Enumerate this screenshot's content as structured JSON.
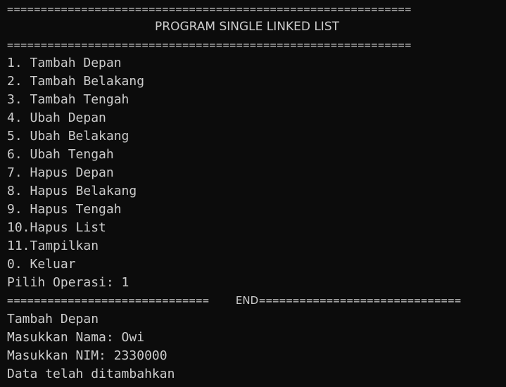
{
  "terminal": {
    "top_separator": "============================================================",
    "title": "PROGRAM SINGLE LINKED LIST",
    "title_separator": "============================================================",
    "menu_items": [
      "1. Tambah Depan",
      "2. Tambah Belakang",
      "3. Tambah Tengah",
      "4. Ubah Depan",
      "5. Ubah Belakang",
      "6. Ubah Tengah",
      "7. Hapus Depan",
      "8. Hapus Belakang",
      "9. Hapus Tengah",
      "10.Hapus List",
      "11.Tampilkan",
      "0. Keluar"
    ],
    "prompt": "Pilih Operasi: 1",
    "end_left": "==============================",
    "end_label": "END",
    "end_right": "==============================",
    "output_lines": [
      "Tambah Depan",
      "Masukkan Nama: Owi",
      "Masukkan NIM: 2330000",
      "Data telah ditambahkan"
    ],
    "colors": {
      "background": "#0c0c0c",
      "foreground": "#cccccc"
    }
  }
}
